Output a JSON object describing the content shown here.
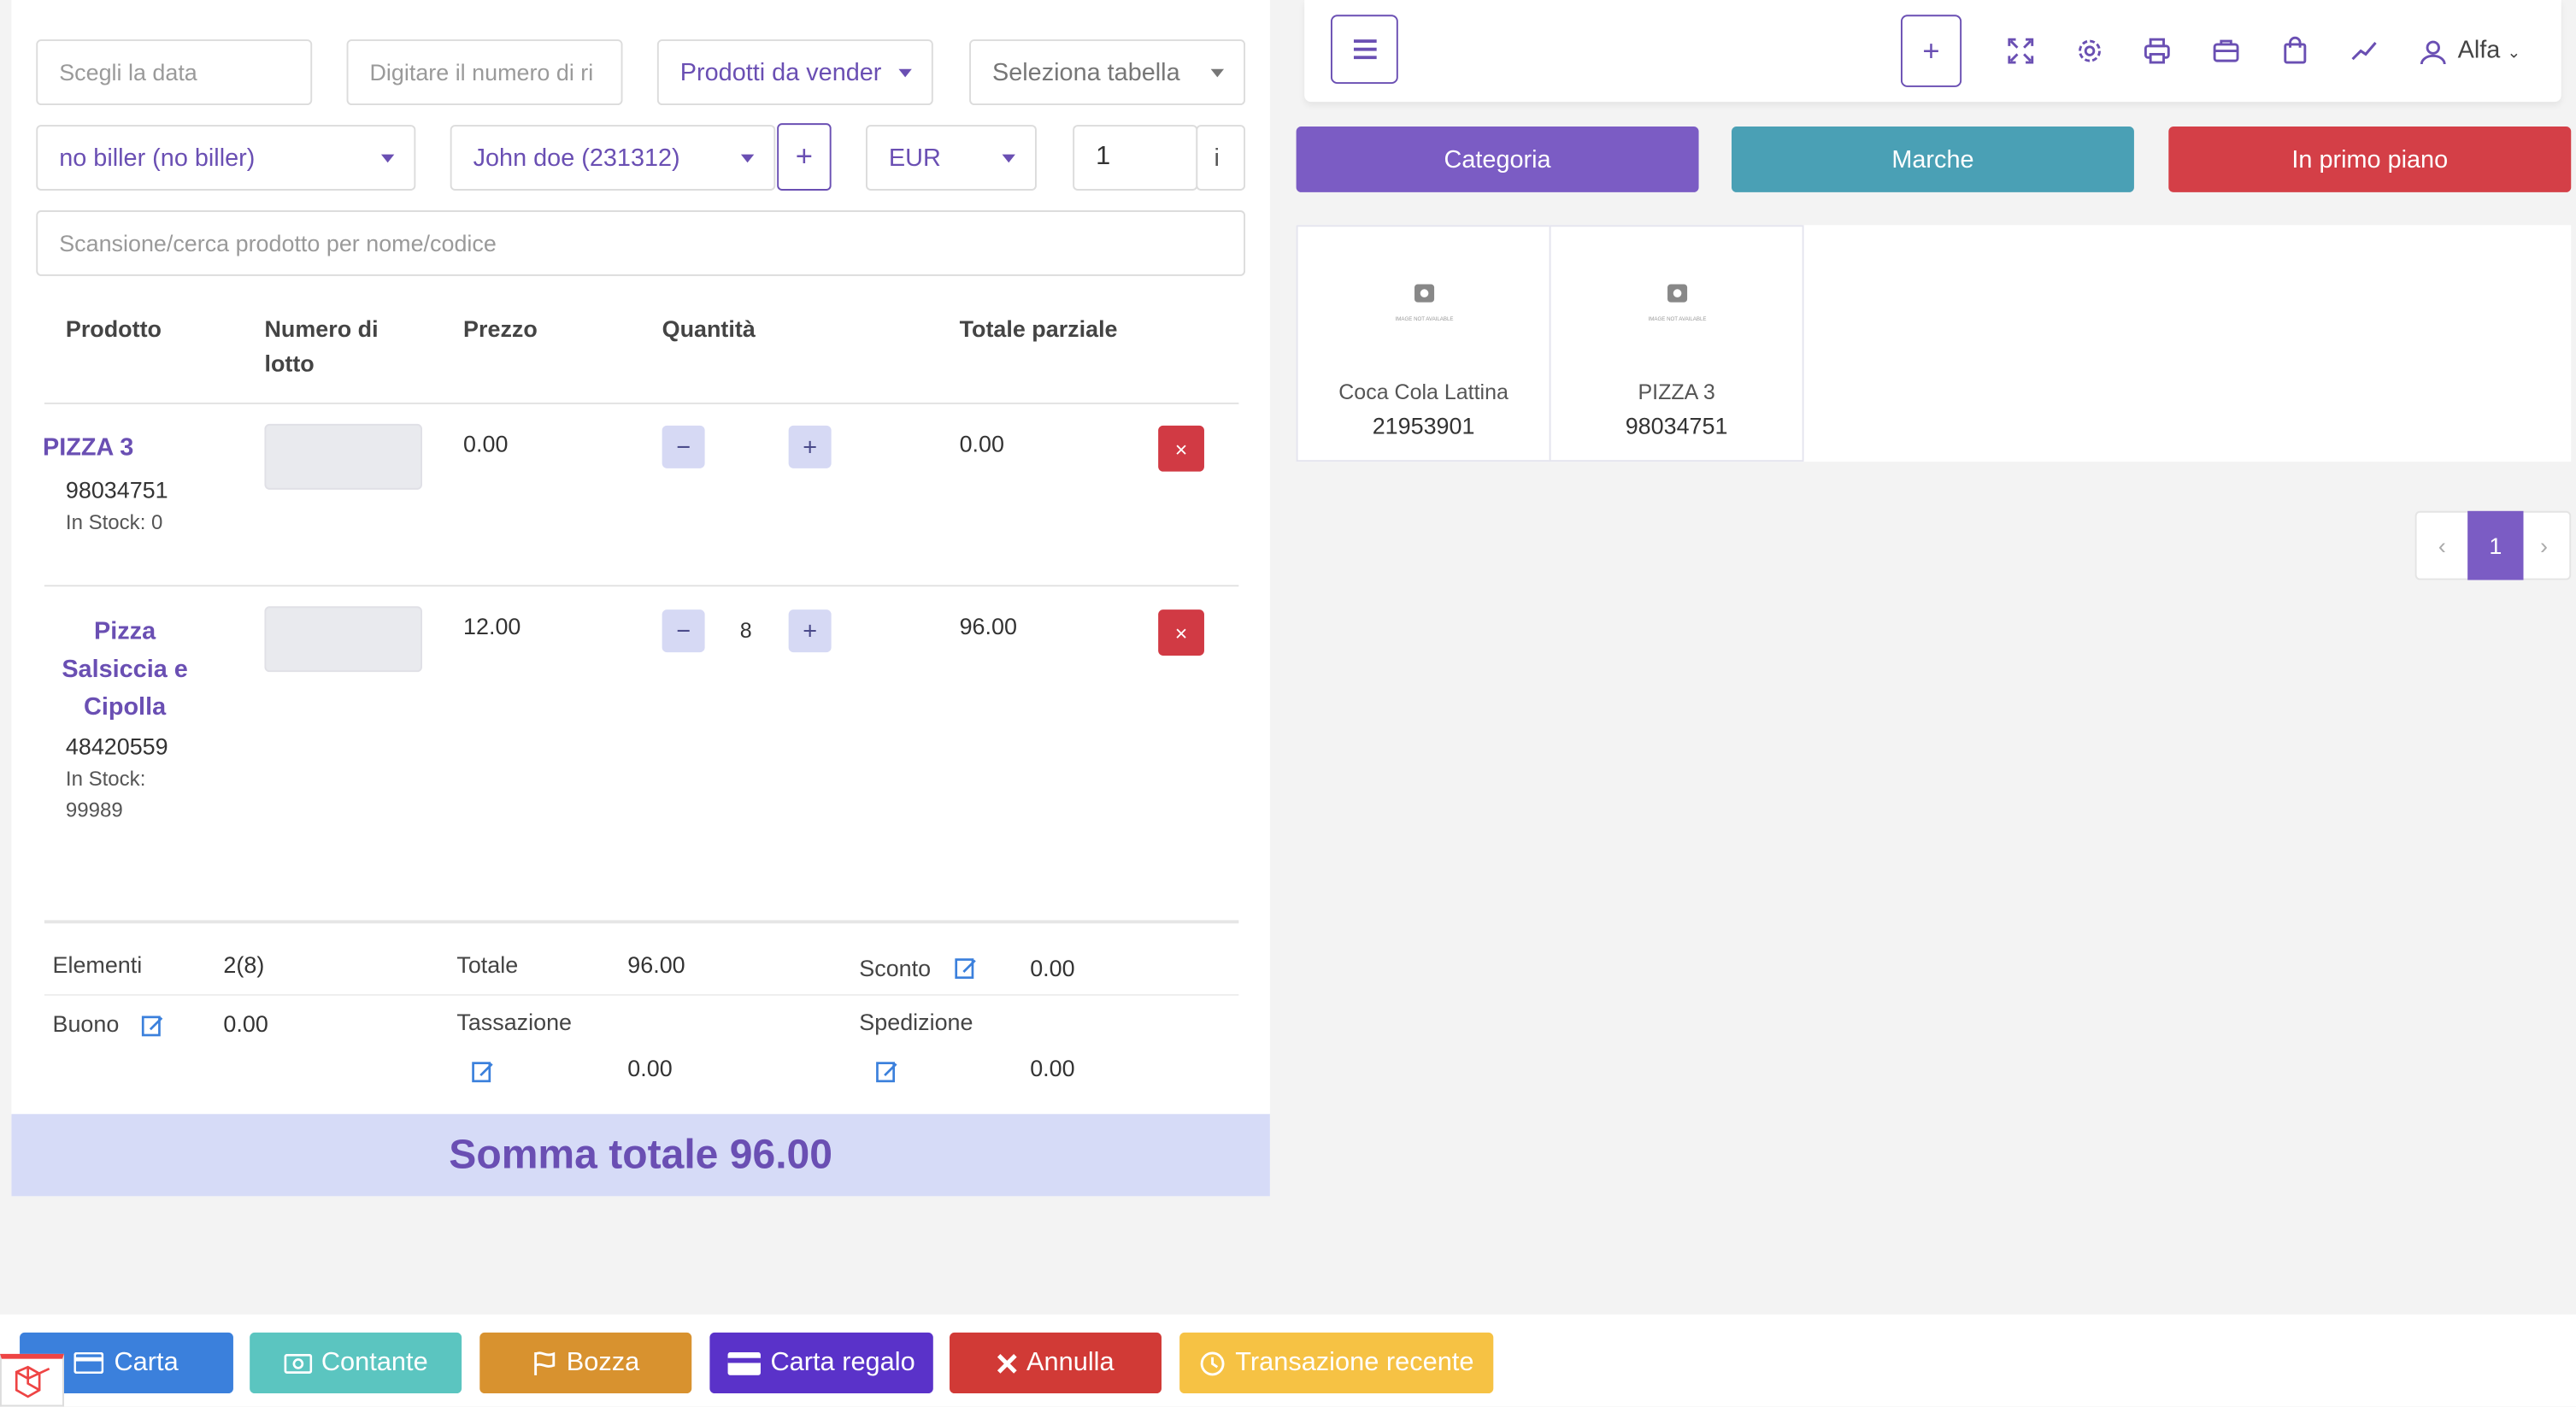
{
  "form": {
    "date_placeholder": "Scegli la data",
    "ref_placeholder": "Digitare il numero di ri",
    "products_to_sell": "Prodotti da vender",
    "select_table": "Seleziona tabella",
    "biller": "no biller (no biller)",
    "customer": "John doe (231312)",
    "add_customer": "+",
    "currency": "EUR",
    "exchange_rate": "1",
    "info": "i",
    "scan_placeholder": "Scansione/cerca prodotto per nome/codice"
  },
  "table": {
    "headers": [
      "Prodotto",
      "Numero di lotto",
      "Prezzo",
      "Quantità",
      "Totale parziale"
    ],
    "rows": [
      {
        "name": "PIZZA 3",
        "code": "98034751",
        "stock": "In Stock: 0",
        "price": "0.00",
        "qty": "",
        "subtotal": "0.00"
      },
      {
        "name": "Pizza Salsiccia e Cipolla",
        "code": "48420559",
        "stock": "In Stock: 99989",
        "price": "12.00",
        "qty": "8",
        "subtotal": "96.00"
      }
    ],
    "minus": "−",
    "plus": "+",
    "delete": "×"
  },
  "summary": {
    "items_label": "Elementi",
    "items_value": "2(8)",
    "total_label": "Totale",
    "total_value": "96.00",
    "discount_label": "Sconto",
    "discount_value": "0.00",
    "coupon_label": "Buono",
    "coupon_value": "0.00",
    "tax_label": "Tassazione",
    "tax_value": "0.00",
    "shipping_label": "Spedizione",
    "shipping_value": "0.00",
    "grand_total": "Somma totale 96.00"
  },
  "topbar": {
    "add": "+",
    "user": "Alfa"
  },
  "filters": {
    "category": "Categoria",
    "brands": "Marche",
    "featured": "In primo piano"
  },
  "products": [
    {
      "name": "Coca Cola Lattina",
      "code": "21953901",
      "image_caption": "IMAGE NOT AVAILABLE"
    },
    {
      "name": "PIZZA 3",
      "code": "98034751",
      "image_caption": "IMAGE NOT AVAILABLE"
    }
  ],
  "pagination": {
    "prev": "‹",
    "current": "1",
    "next": "›"
  },
  "actions": {
    "card": "Carta",
    "cash": "Contante",
    "draft": "Bozza",
    "gift_card": "Carta regalo",
    "cancel": "Annulla",
    "recent": "Transazione recente"
  },
  "colors": {
    "primary": "#6a4fb3",
    "category": "#7b5cc4",
    "brands": "#4aa0b5",
    "featured": "#d43f47",
    "card": "#3b80dc",
    "cash": "#5bc5c0",
    "draft": "#d8922f",
    "gift_card": "#5a32c9",
    "cancel": "#d13a36",
    "recent": "#f6c244"
  }
}
